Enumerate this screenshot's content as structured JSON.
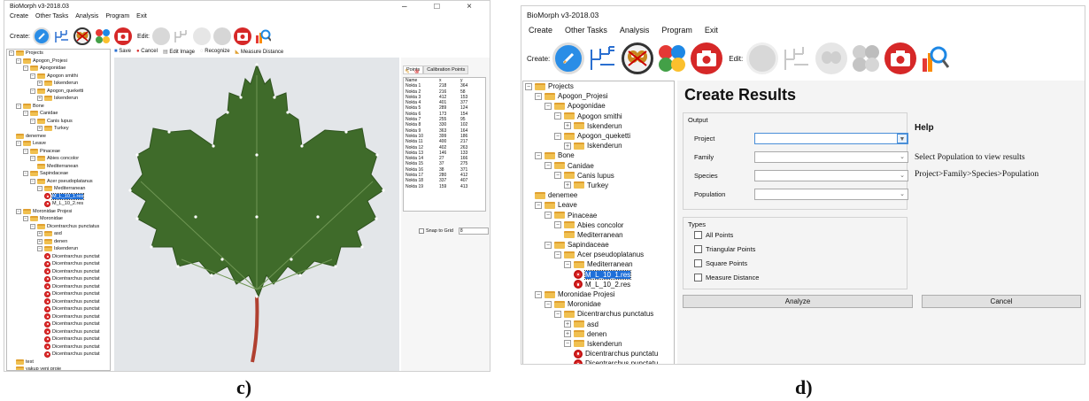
{
  "captions": {
    "c": "c)",
    "d": "d)"
  },
  "app_title": "BioMorph v3-2018.03",
  "menu": [
    "Create",
    "Other Tasks",
    "Analysis",
    "Program",
    "Exit"
  ],
  "toolbar": {
    "create_label": "Create:",
    "edit_label": "Edit:"
  },
  "fig_c": {
    "window_controls": "– □ ×",
    "image_toolbar": [
      "Save",
      "Cancel",
      "Edit Image",
      "Recognize",
      "Measure Distance"
    ],
    "tabs": [
      "Points",
      "Calibration Points"
    ],
    "points_header": [
      "Name",
      "x",
      "y"
    ],
    "points": [
      [
        "Nokta 1",
        "218",
        "364"
      ],
      [
        "Nokta 2",
        "216",
        "58"
      ],
      [
        "Nokta 3",
        "412",
        "153"
      ],
      [
        "Nokta 4",
        "401",
        "377"
      ],
      [
        "Nokta 5",
        "289",
        "124"
      ],
      [
        "Nokta 6",
        "173",
        "154"
      ],
      [
        "Nokta 7",
        "255",
        "95"
      ],
      [
        "Nokta 8",
        "330",
        "102"
      ],
      [
        "Nokta 9",
        "363",
        "164"
      ],
      [
        "Nokta 10",
        "399",
        "186"
      ],
      [
        "Nokta 11",
        "400",
        "217"
      ],
      [
        "Nokta 12",
        "402",
        "263"
      ],
      [
        "Nokta 13",
        "146",
        "133"
      ],
      [
        "Nokta 14",
        "27",
        "166"
      ],
      [
        "Nokta 15",
        "37",
        "275"
      ],
      [
        "Nokta 16",
        "38",
        "371"
      ],
      [
        "Nokta 17",
        "280",
        "412"
      ],
      [
        "Nokta 18",
        "337",
        "407"
      ],
      [
        "Nokta 19",
        "159",
        "413"
      ]
    ],
    "snap_label": "Snap to Grid",
    "snap_value": "8",
    "tree": [
      {
        "d": 0,
        "t": "f",
        "e": "-",
        "l": "Projects"
      },
      {
        "d": 1,
        "t": "f",
        "e": "-",
        "l": "Apogon_Projesi"
      },
      {
        "d": 2,
        "t": "f",
        "e": "-",
        "l": "Apogonidae"
      },
      {
        "d": 3,
        "t": "f",
        "e": "-",
        "l": "Apogon smithi"
      },
      {
        "d": 4,
        "t": "f",
        "e": "+",
        "l": "Iskenderun"
      },
      {
        "d": 3,
        "t": "f",
        "e": "-",
        "l": "Apogon_queketti"
      },
      {
        "d": 4,
        "t": "f",
        "e": "+",
        "l": "Iskenderun"
      },
      {
        "d": 1,
        "t": "f",
        "e": "-",
        "l": "Bone"
      },
      {
        "d": 2,
        "t": "f",
        "e": "-",
        "l": "Canidae"
      },
      {
        "d": 3,
        "t": "f",
        "e": "-",
        "l": "Canis lupus"
      },
      {
        "d": 4,
        "t": "f",
        "e": "+",
        "l": "Turkey"
      },
      {
        "d": 1,
        "t": "f",
        "e": "",
        "l": "denemee"
      },
      {
        "d": 1,
        "t": "f",
        "e": "-",
        "l": "Leave"
      },
      {
        "d": 2,
        "t": "f",
        "e": "-",
        "l": "Pinaceae"
      },
      {
        "d": 3,
        "t": "f",
        "e": "-",
        "l": "Abies concolor"
      },
      {
        "d": 4,
        "t": "f",
        "e": "",
        "l": "Mediterranean"
      },
      {
        "d": 2,
        "t": "f",
        "e": "-",
        "l": "Sapindaceae"
      },
      {
        "d": 3,
        "t": "f",
        "e": "-",
        "l": "Acer pseudoplatanus"
      },
      {
        "d": 4,
        "t": "f",
        "e": "-",
        "l": "Mediterranean"
      },
      {
        "d": 5,
        "t": "r",
        "e": "",
        "l": "M_L_10_1.res",
        "s": true
      },
      {
        "d": 5,
        "t": "r",
        "e": "",
        "l": "M_L_10_2.res"
      },
      {
        "d": 1,
        "t": "f",
        "e": "-",
        "l": "Moronidae Projesi"
      },
      {
        "d": 2,
        "t": "f",
        "e": "-",
        "l": "Moronidae"
      },
      {
        "d": 3,
        "t": "f",
        "e": "-",
        "l": "Dicentrarchus punctatus"
      },
      {
        "d": 4,
        "t": "f",
        "e": "+",
        "l": "asd"
      },
      {
        "d": 4,
        "t": "f",
        "e": "+",
        "l": "denen"
      },
      {
        "d": 4,
        "t": "f",
        "e": "-",
        "l": "Iskenderun"
      },
      {
        "d": 5,
        "t": "r",
        "e": "",
        "l": "Dicentrarchus punctat"
      },
      {
        "d": 5,
        "t": "r",
        "e": "",
        "l": "Dicentrarchus punctat"
      },
      {
        "d": 5,
        "t": "r",
        "e": "",
        "l": "Dicentrarchus punctat"
      },
      {
        "d": 5,
        "t": "r",
        "e": "",
        "l": "Dicentrarchus punctat"
      },
      {
        "d": 5,
        "t": "r",
        "e": "",
        "l": "Dicentrarchus punctat"
      },
      {
        "d": 5,
        "t": "r",
        "e": "",
        "l": "Dicentrarchus punctat"
      },
      {
        "d": 5,
        "t": "r",
        "e": "",
        "l": "Dicentrarchus punctat"
      },
      {
        "d": 5,
        "t": "r",
        "e": "",
        "l": "Dicentrarchus punctat"
      },
      {
        "d": 5,
        "t": "r",
        "e": "",
        "l": "Dicentrarchus punctat"
      },
      {
        "d": 5,
        "t": "r",
        "e": "",
        "l": "Dicentrarchus punctat"
      },
      {
        "d": 5,
        "t": "r",
        "e": "",
        "l": "Dicentrarchus punctat"
      },
      {
        "d": 5,
        "t": "r",
        "e": "",
        "l": "Dicentrarchus punctat"
      },
      {
        "d": 5,
        "t": "r",
        "e": "",
        "l": "Dicentrarchus punctat"
      },
      {
        "d": 5,
        "t": "r",
        "e": "",
        "l": "Dicentrarchus punctat"
      },
      {
        "d": 1,
        "t": "f",
        "e": "",
        "l": "test"
      },
      {
        "d": 1,
        "t": "f",
        "e": "",
        "l": "yakup yeni proje"
      }
    ]
  },
  "fig_d": {
    "title": "Create Results",
    "output_group": "Output",
    "fields": [
      {
        "label": "Project",
        "value": ""
      },
      {
        "label": "Family",
        "value": ""
      },
      {
        "label": "Species",
        "value": ""
      },
      {
        "label": "Population",
        "value": ""
      }
    ],
    "types_group": "Types",
    "types": [
      "All Points",
      "Triangular Points",
      "Square Points",
      "Measure Distance"
    ],
    "help_title": "Help",
    "help_line1": "Select Population to view results",
    "help_line2": "Project>Family>Species>Population",
    "analyze_button": "Analyze",
    "cancel_button": "Cancel",
    "tree": [
      {
        "d": 0,
        "t": "f",
        "e": "-",
        "l": "Projects"
      },
      {
        "d": 1,
        "t": "f",
        "e": "-",
        "l": "Apogon_Projesi"
      },
      {
        "d": 2,
        "t": "f",
        "e": "-",
        "l": "Apogonidae"
      },
      {
        "d": 3,
        "t": "f",
        "e": "-",
        "l": "Apogon smithi"
      },
      {
        "d": 4,
        "t": "f",
        "e": "+",
        "l": "Iskenderun"
      },
      {
        "d": 3,
        "t": "f",
        "e": "-",
        "l": "Apogon_queketti"
      },
      {
        "d": 4,
        "t": "f",
        "e": "+",
        "l": "Iskenderun"
      },
      {
        "d": 1,
        "t": "f",
        "e": "-",
        "l": "Bone"
      },
      {
        "d": 2,
        "t": "f",
        "e": "-",
        "l": "Canidae"
      },
      {
        "d": 3,
        "t": "f",
        "e": "-",
        "l": "Canis lupus"
      },
      {
        "d": 4,
        "t": "f",
        "e": "+",
        "l": "Turkey"
      },
      {
        "d": 1,
        "t": "f",
        "e": "",
        "l": "denemee"
      },
      {
        "d": 1,
        "t": "f",
        "e": "-",
        "l": "Leave"
      },
      {
        "d": 2,
        "t": "f",
        "e": "-",
        "l": "Pinaceae"
      },
      {
        "d": 3,
        "t": "f",
        "e": "-",
        "l": "Abies concolor"
      },
      {
        "d": 4,
        "t": "f",
        "e": "",
        "l": "Mediterranean"
      },
      {
        "d": 2,
        "t": "f",
        "e": "-",
        "l": "Sapindaceae"
      },
      {
        "d": 3,
        "t": "f",
        "e": "-",
        "l": "Acer pseudoplatanus"
      },
      {
        "d": 4,
        "t": "f",
        "e": "-",
        "l": "Mediterranean"
      },
      {
        "d": 5,
        "t": "r",
        "e": "",
        "l": "M_L_10_1.res",
        "s": true
      },
      {
        "d": 5,
        "t": "r",
        "e": "",
        "l": "M_L_10_2.res"
      },
      {
        "d": 1,
        "t": "f",
        "e": "-",
        "l": "Moronidae Projesi"
      },
      {
        "d": 2,
        "t": "f",
        "e": "-",
        "l": "Moronidae"
      },
      {
        "d": 3,
        "t": "f",
        "e": "-",
        "l": "Dicentrarchus punctatus"
      },
      {
        "d": 4,
        "t": "f",
        "e": "+",
        "l": "asd"
      },
      {
        "d": 4,
        "t": "f",
        "e": "+",
        "l": "denen"
      },
      {
        "d": 4,
        "t": "f",
        "e": "-",
        "l": "Iskenderun"
      },
      {
        "d": 5,
        "t": "r",
        "e": "",
        "l": "Dicentrarchus punctatu"
      },
      {
        "d": 5,
        "t": "r",
        "e": "",
        "l": "Dicentrarchus punctatu"
      },
      {
        "d": 5,
        "t": "r",
        "e": "",
        "l": "Dicentrarchus punctatu"
      }
    ]
  },
  "colors": {
    "selection": "#1e6fd9",
    "folder": "#f0c050",
    "result_icon": "#e03030",
    "leaf": "#3f6b2a"
  },
  "icons": [
    "new-project-icon",
    "tree-icon",
    "butterfly-icon",
    "color-palette-icon",
    "camera-icon",
    "magnifier-icon"
  ]
}
